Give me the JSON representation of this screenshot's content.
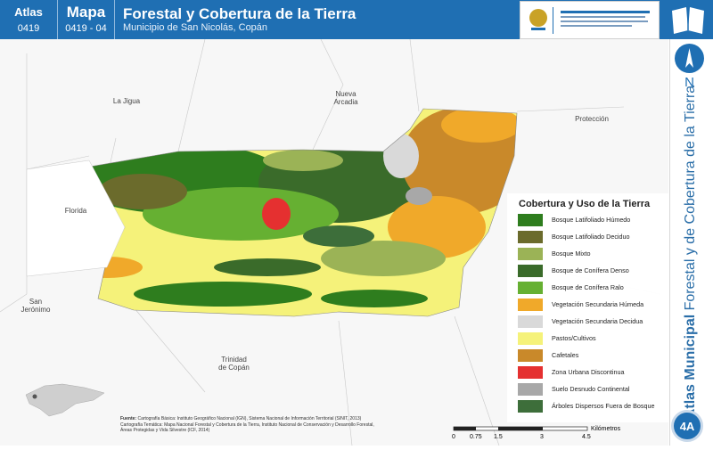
{
  "header": {
    "atlas_label": "Atlas",
    "atlas_number": "0419",
    "mapa_label": "Mapa",
    "mapa_number": "0419 - 04",
    "title": "Forestal y Cobertura de la Tierra",
    "subtitle": "Municipio de San Nicolás, Copán",
    "colors": {
      "header_bg": "#1f6fb3"
    }
  },
  "side": {
    "north_letter": "N",
    "vertical_title_bold": "Atlas Municipal",
    "vertical_title_rest": " Forestal y de Cobertura de la Tierra",
    "badge": "4A"
  },
  "map": {
    "towns": [
      {
        "name": "La Jigua"
      },
      {
        "name": "Nueva\nArcadia"
      },
      {
        "name": "Protección"
      },
      {
        "name": "Florida"
      },
      {
        "name": "San\nJerónimo"
      },
      {
        "name": "Trinidad\nde Copán"
      }
    ]
  },
  "legend": {
    "title": "Cobertura y Uso de la Tierra",
    "items": [
      {
        "label": "Bosque Latifoliado Húmedo",
        "color": "#2e7d1e"
      },
      {
        "label": "Bosque Latifoliado Deciduo",
        "color": "#6b6b2c"
      },
      {
        "label": "Bosque Mixto",
        "color": "#9bb356"
      },
      {
        "label": "Bosque de Conífera Denso",
        "color": "#3a6b2a"
      },
      {
        "label": "Bosque de Conífera Ralo",
        "color": "#66b032"
      },
      {
        "label": "Vegetación Secundaria Húmeda",
        "color": "#f0a92a"
      },
      {
        "label": "Vegetación Secundaria Decidua",
        "color": "#d9d9d9"
      },
      {
        "label": "Pastos/Cultivos",
        "color": "#f5f27a"
      },
      {
        "label": "Cafetales",
        "color": "#c9892a"
      },
      {
        "label": "Zona Urbana Discontinua",
        "color": "#e53030"
      },
      {
        "label": "Suelo Desnudo Continental",
        "color": "#a8a8a8"
      },
      {
        "label": "Árboles Dispersos Fuera de Bosque",
        "color": "#3d6e3a"
      }
    ]
  },
  "source": {
    "label": "Fuente:",
    "line1": "Cartografía Básica: Instituto Geográfico Nacional (IGN), Sistema Nacional de Información Territorial (SINIT, 2013)",
    "line2": "Cartografía Temática: Mapa Nacional Forestal y Cobertura de la Tierra, Instituto Nacional de Conservación y Desarrollo Forestal,",
    "line3": "Áreas Protegidas y Vida Silvestre (ICF, 2014)"
  },
  "scale": {
    "ticks": [
      "0",
      "0.75",
      "1.5",
      "3",
      "4.5"
    ],
    "unit": "Kilómetros"
  }
}
